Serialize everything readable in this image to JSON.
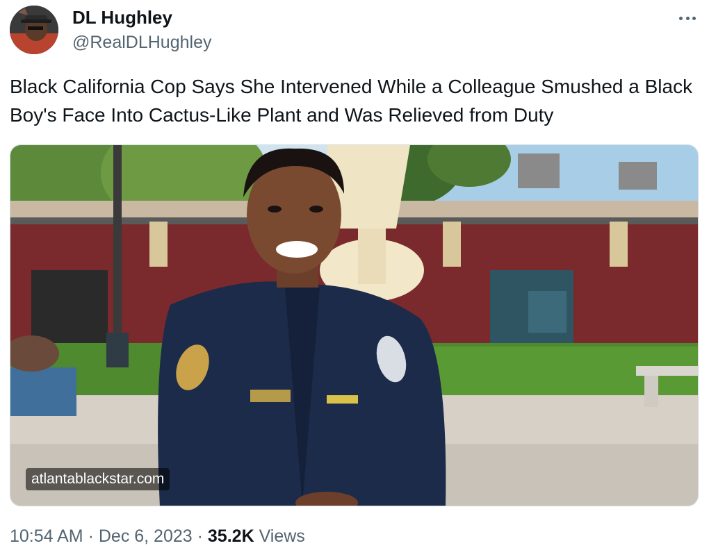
{
  "author": {
    "display_name": "DL Hughley",
    "handle": "@RealDLHughley"
  },
  "more_menu_icon": "ellipsis-icon",
  "tweet_text": "Black California Cop Says She Intervened While a Colleague Smushed a Black Boy's Face Into Cactus-Like Plant and Was Relieved from Duty",
  "media": {
    "watermark": "atlantablackstar.com"
  },
  "meta": {
    "time": "10:54 AM",
    "separator_1": " · ",
    "date": "Dec 6, 2023",
    "separator_2": " · ",
    "views_count": "35.2K",
    "views_label": " Views"
  },
  "colors": {
    "text_primary": "#0f1419",
    "text_secondary": "#536471",
    "border": "#cfd9de"
  }
}
